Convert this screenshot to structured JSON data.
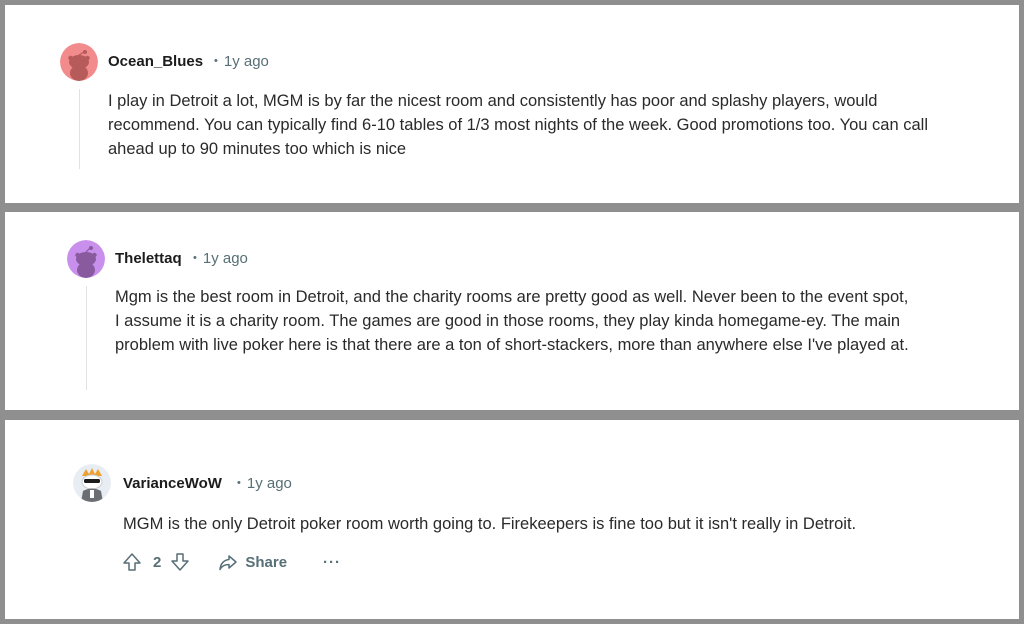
{
  "comments": [
    {
      "author": "Ocean_Blues",
      "time": "1y ago",
      "avatar_color": "#f08080",
      "body": "I play in Detroit a lot, MGM is by far the nicest room and consistently has poor and splashy players, would recommend. You can typically find 6-10 tables of 1/3 most nights of the week. Good promotions too. You can call ahead up to 90 minutes too which is nice"
    },
    {
      "author": "Thelettaq",
      "time": "1y ago",
      "avatar_color": "#c08be8",
      "body": "Mgm is the best room in Detroit, and the charity rooms are pretty good as well. Never been to the event spot, I assume it is a charity room. The games are good in those rooms, they play kinda homegame-ey. The main problem with live poker here is that there are a ton of short-stackers, more than anywhere else I've played at."
    },
    {
      "author": "VarianceWoW",
      "time": "1y ago",
      "avatar_color": "#e7edf2",
      "body": "MGM is the only Detroit poker room worth going to. Firekeepers is fine too but it isn't really in Detroit.",
      "vote_count": "2",
      "share_label": "Share",
      "more_label": "···"
    }
  ],
  "icons": {
    "upvote": "upvote-icon",
    "downvote": "downvote-icon",
    "share": "share-icon",
    "avatar": "snoo-avatar-icon"
  },
  "colors": {
    "meta_text": "#576f76",
    "background_gap": "#8f8f8f"
  }
}
